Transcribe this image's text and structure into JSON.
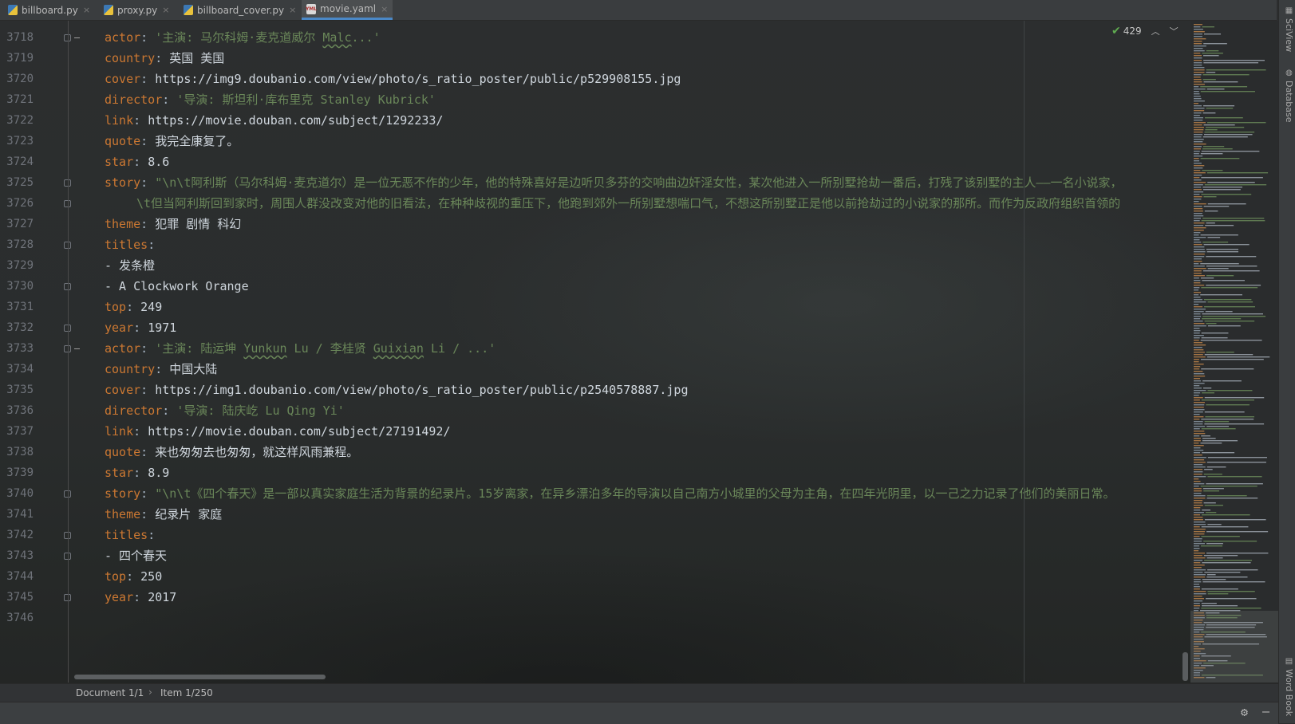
{
  "tabs": [
    {
      "label": "billboard.py",
      "icon": "python-file-icon",
      "active": false
    },
    {
      "label": "proxy.py",
      "icon": "python-file-icon",
      "active": false
    },
    {
      "label": "billboard_cover.py",
      "icon": "python-file-icon",
      "active": false
    },
    {
      "label": "movie.yaml",
      "icon": "yaml-file-icon",
      "active": true
    }
  ],
  "inspection": {
    "count": "429"
  },
  "right_tools": [
    "SciView",
    "Database",
    "Word Book"
  ],
  "breadcrumb": [
    "Document 1/1",
    "Item 1/250"
  ],
  "line_numbers": [
    "3718",
    "3719",
    "3720",
    "3721",
    "3722",
    "3723",
    "3724",
    "3725",
    "3726",
    "3727",
    "3728",
    "3729",
    "3730",
    "3731",
    "3732",
    "3733",
    "3734",
    "3735",
    "3736",
    "3737",
    "3738",
    "3739",
    "3740",
    "3741",
    "3742",
    "3743",
    "3744",
    "3745",
    "3746"
  ],
  "code": {
    "l3718": {
      "key": "actor",
      "s1": "'主演: 马尔科姆·麦克道威尔 ",
      "u1": "Malc",
      "s2": "...'"
    },
    "l3719": {
      "key": "country",
      "val": "英国 美国"
    },
    "l3720": {
      "key": "cover",
      "val": "https://img9.doubanio.com/view/photo/s_ratio_poster/public/p529908155.jpg"
    },
    "l3721": {
      "key": "director",
      "str": "'导演: 斯坦利·库布里克 Stanley Kubrick'"
    },
    "l3722": {
      "key": "link",
      "val": "https://movie.douban.com/subject/1292233/"
    },
    "l3723": {
      "key": "quote",
      "val": "我完全康复了。"
    },
    "l3724": {
      "key": "star",
      "val": "8.6"
    },
    "l3725": {
      "key": "story",
      "str": "\"\\n\\t阿利斯（马尔科姆·麦克道尔）是一位无恶不作的少年，他的特殊喜好是边听贝多芬的交响曲边奸淫女性，某次他进入一所别墅抢劫一番后，打残了该别墅的主人——一名小说家，"
    },
    "l3726": {
      "str": "\\t但当阿利斯回到家时，周围人群没改变对他的旧看法，在种种歧视的重压下，他跑到郊外一所别墅想喘口气，不想这所别墅正是他以前抢劫过的小说家的那所。而作为反政府组织首领的"
    },
    "l3727": {
      "key": "theme",
      "val": "犯罪 剧情 科幻"
    },
    "l3728": {
      "key": "titles"
    },
    "l3729": {
      "val": "- 发条橙"
    },
    "l3730": {
      "val": "- A Clockwork Orange"
    },
    "l3731": {
      "key": "top",
      "val": "249"
    },
    "l3732": {
      "key": "year",
      "val": "1971"
    },
    "l3733": {
      "key": "actor",
      "s1": "'主演: 陆运坤 ",
      "u1": "Yunkun",
      "s2": " Lu / 李桂贤 ",
      "u2": "Guixian",
      "s3": " Li / ...'"
    },
    "l3734": {
      "key": "country",
      "val": "中国大陆"
    },
    "l3735": {
      "key": "cover",
      "val": "https://img1.doubanio.com/view/photo/s_ratio_poster/public/p2540578887.jpg"
    },
    "l3736": {
      "key": "director",
      "str": "'导演: 陆庆屹 Lu Qing Yi'"
    },
    "l3737": {
      "key": "link",
      "val": "https://movie.douban.com/subject/27191492/"
    },
    "l3738": {
      "key": "quote",
      "val": "来也匆匆去也匆匆，就这样风雨兼程。"
    },
    "l3739": {
      "key": "star",
      "val": "8.9"
    },
    "l3740": {
      "key": "story",
      "str": "\"\\n\\t《四个春天》是一部以真实家庭生活为背景的纪录片。15岁离家，在异乡漂泊多年的导演以自己南方小城里的父母为主角，在四年光阴里，以一己之力记录了他们的美丽日常。"
    },
    "l3741": {
      "key": "theme",
      "val": "纪录片 家庭"
    },
    "l3742": {
      "key": "titles"
    },
    "l3743": {
      "val": "- 四个春天"
    },
    "l3744": {
      "key": "top",
      "val": "250"
    },
    "l3745": {
      "key": "year",
      "val": "2017"
    }
  }
}
